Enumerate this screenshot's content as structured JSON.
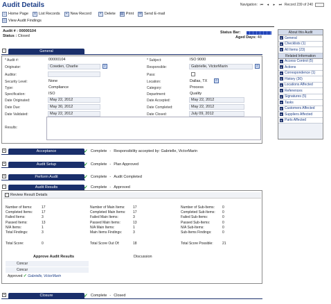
{
  "window": {
    "title": "Audit Details"
  },
  "navigation": {
    "label": "Navigation:",
    "record": "Record 239 of 240",
    "first": "⏮",
    "prev": "◂",
    "next": "▸",
    "last": "⏭"
  },
  "toolbar": {
    "home": "Home Page",
    "list": "List Records",
    "new": "New Record",
    "delete": "Delete",
    "print": "Print",
    "email": "Send E-mail",
    "view_findings": "View Audit Findings"
  },
  "header": {
    "audit_label": "Audit # :",
    "audit_number": "00000104",
    "status_label": "Status :",
    "status_value": "Closed",
    "status_bar_label": "Status Bar:",
    "aged_label": "Aged Days:",
    "aged_value": "48"
  },
  "general": {
    "tab": "General",
    "audit_no_label": "* Audit #:",
    "audit_no": "00000104",
    "subject_label": "* Subject:",
    "subject": "ISO 9000",
    "originator_label": "Originator:",
    "originator": "Cowden, Charlie",
    "responsible_label": "Responsible:",
    "responsible": "Gabrielle, VictorMarin",
    "auditor_label": "Auditor:",
    "auditor": "",
    "pass_label": "Pass:",
    "security_label": "Security Level:",
    "security": "None",
    "location_label": "Location:",
    "location": "Dallas, TX",
    "type_label": "Type:",
    "type": "Compliance",
    "category_label": "Category:",
    "category": "Process",
    "spec_label": "Specification:",
    "spec": "ISO",
    "dept_label": "Department:",
    "dept": "Quality",
    "date_orig_label": "Date Originated:",
    "date_orig": "May 22, 2012",
    "date_accepted_label": "Date Accepted:",
    "date_accepted": "May 22, 2012",
    "date_due_label": "Date Due:",
    "date_due": "May 30, 2012",
    "date_completed_label": "Date Completed:",
    "date_completed": "May 22, 2012",
    "date_validated_label": "Date Validated:",
    "date_validated": "May 22, 2012",
    "date_closed_label": "Date Closed:",
    "date_closed": "July 09, 2012",
    "results_label": "Results:"
  },
  "right_panel": {
    "about": "About this Audit",
    "items": [
      "General",
      "Checklists (1)",
      "All Items (23)"
    ],
    "related": "Related Information",
    "related_items": [
      "Access Control (5)",
      "Actions",
      "Correspondence (1)",
      "History (30)",
      "Locations Affected",
      "References",
      "Signatures (5)",
      "Tasks",
      "Customers Affected",
      "Suppliers Affected",
      "Parts Affected"
    ]
  },
  "workflow": {
    "acceptance": {
      "tab": "Acceptance",
      "status": "Complete",
      "sep": "-",
      "note": "Responsibility accepted by: Gabrielle, VictorMarin"
    },
    "setup": {
      "tab": "Audit Setup",
      "status": "Complete",
      "sep": "-",
      "note": "Plan Approved"
    },
    "perform": {
      "tab": "Perform Audit",
      "status": "Complete",
      "sep": "-",
      "note": "Audit Completed"
    },
    "results": {
      "tab": "Audit Results",
      "status": "Complete",
      "sep": "-",
      "note": "Approved"
    },
    "closure": {
      "tab": "Closure",
      "status": "Complete",
      "sep": "-",
      "note": "Closed"
    }
  },
  "review": {
    "title": "Review Result Details",
    "col1": [
      {
        "label": "Number of Items:",
        "value": "17"
      },
      {
        "label": "Completed Items:",
        "value": "17"
      },
      {
        "label": "Failed Items:",
        "value": "3"
      },
      {
        "label": "Passed Items:",
        "value": "13"
      },
      {
        "label": "N/A Items:",
        "value": "1"
      },
      {
        "label": "Total Findings:",
        "value": "3"
      }
    ],
    "col2": [
      {
        "label": "Number of Main Items:",
        "value": "17"
      },
      {
        "label": "Completed Main Items:",
        "value": "17"
      },
      {
        "label": "Failed Main Items:",
        "value": "3"
      },
      {
        "label": "Passed Main Items:",
        "value": "13"
      },
      {
        "label": "N/A Main Items:",
        "value": "1"
      },
      {
        "label": "Main Items Findings:",
        "value": "3"
      }
    ],
    "col3": [
      {
        "label": "Number of Sub-Items:",
        "value": "0"
      },
      {
        "label": "Completed Sub-Items:",
        "value": "0"
      },
      {
        "label": "Failed Sub-Items:",
        "value": "0"
      },
      {
        "label": "Passed Sub-Items:",
        "value": "0"
      },
      {
        "label": "N/A Sub-Items:",
        "value": "0"
      },
      {
        "label": "Sub-Items Findings:",
        "value": "0"
      }
    ],
    "total_score_label": "Total Score:",
    "total_score": "0",
    "total_out_label": "Total Score Out Of:",
    "total_out": "18",
    "total_possible_label": "Total Score Possible:",
    "total_possible": "21",
    "approve_title": "Approve Audit Results",
    "discussion_title": "Discussion",
    "approvals": [
      {
        "label": "Concur",
        "name": ""
      },
      {
        "label": "Concur",
        "name": ""
      },
      {
        "label": "Approved",
        "name": "Gabrielle, VictorMarin"
      }
    ]
  },
  "icons": {
    "lookup": "magnifier-icon",
    "check": "check-icon",
    "expand": "expand-icon"
  }
}
